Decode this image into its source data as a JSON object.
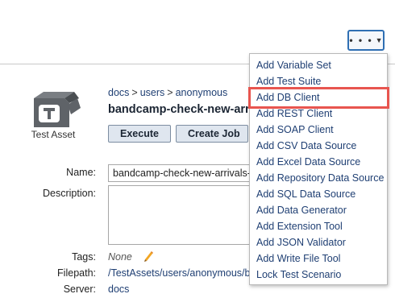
{
  "toolbar": {
    "more_icon": "ellipsis-icon",
    "caret_icon": "caret-down-icon",
    "more_dots": "• • •",
    "caret": "▼"
  },
  "asset": {
    "icon": "test-asset-box-icon",
    "caption": "Test Asset",
    "breadcrumb": [
      "docs",
      "users",
      "anonymous"
    ],
    "breadcrumb_sep": ">",
    "title": "bandcamp-check-new-arrivals-g"
  },
  "actions": {
    "execute": "Execute",
    "create_job": "Create Job"
  },
  "fields": {
    "name_label": "Name:",
    "name_value": "bandcamp-check-new-arrivals-g",
    "description_label": "Description:",
    "tags_label": "Tags:",
    "tags_value": "None",
    "filepath_label": "Filepath:",
    "filepath_value": "/TestAssets/users/anonymous/ba",
    "server_label": "Server:",
    "server_value": "docs"
  },
  "menu": {
    "items": [
      "Add Variable Set",
      "Add Test Suite",
      "Add DB Client",
      "Add REST Client",
      "Add SOAP Client",
      "Add CSV Data Source",
      "Add Excel Data Source",
      "Add Repository Data Source",
      "Add SQL Data Source",
      "Add Data Generator",
      "Add Extension Tool",
      "Add JSON Validator",
      "Add Write File Tool",
      "Lock Test Scenario"
    ],
    "highlighted": "Add DB Client"
  },
  "colors": {
    "link": "#1f3f73",
    "highlight": "#e8554f",
    "button_border": "#2f6fb3"
  }
}
